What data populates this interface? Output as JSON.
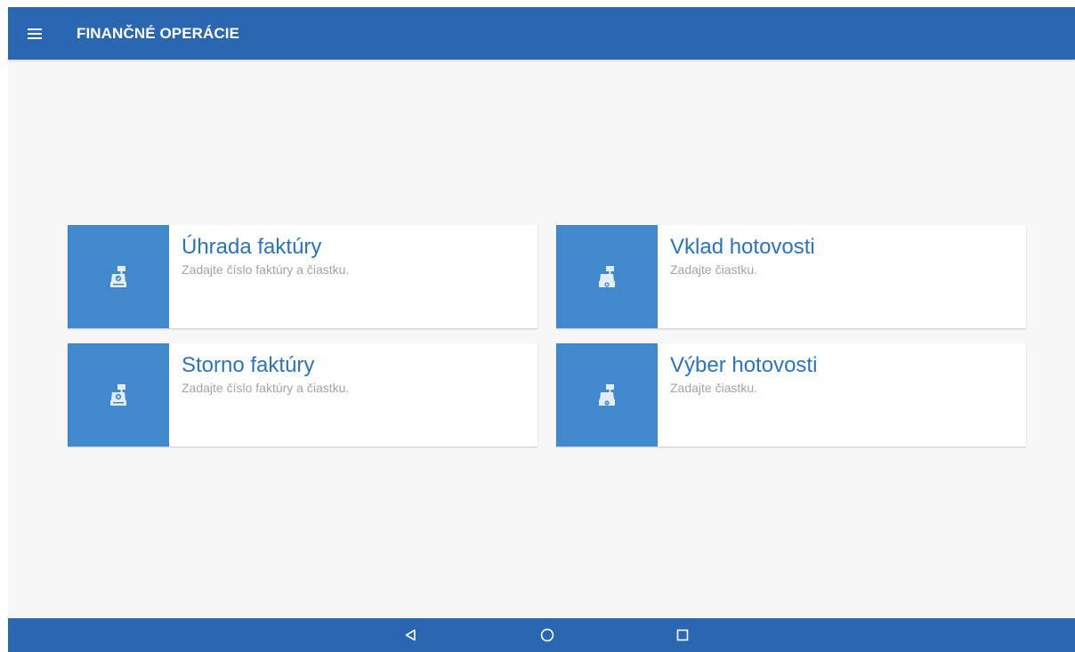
{
  "appbar": {
    "title": "FINANČNÉ OPERÁCIE",
    "menu_icon": "hamburger-menu-icon",
    "color": "#2b66b1"
  },
  "cards": [
    {
      "title": "Úhrada faktúry",
      "subtitle": "Zadajte číslo faktúry a čiastku.",
      "icon": "cash-register-check-icon"
    },
    {
      "title": "Vklad hotovosti",
      "subtitle": "Zadajte čiastku.",
      "icon": "cash-register-deposit-icon"
    },
    {
      "title": "Storno faktúry",
      "subtitle": "Zadajte číslo faktúry a čiastku.",
      "icon": "cash-register-cancel-icon"
    },
    {
      "title": "Výber hotovosti",
      "subtitle": "Zadajte čiastku.",
      "icon": "cash-register-withdraw-icon"
    }
  ],
  "colors": {
    "accent": "#4189cc",
    "title_text": "#2b73c0",
    "subtitle_text": "#a3a3a3",
    "background": "#f7f7f7"
  },
  "navbar": {
    "buttons": [
      "back-icon",
      "home-icon",
      "recents-icon"
    ]
  }
}
